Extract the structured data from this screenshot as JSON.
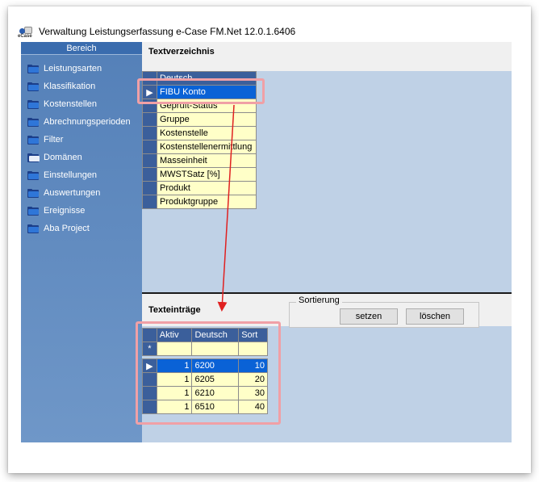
{
  "window": {
    "title": "Verwaltung Leistungserfassung e-Case FM.Net 12.0.1.6406",
    "icon_tag": "eCase"
  },
  "sidebar": {
    "header": "Bereich",
    "items": [
      {
        "label": "Leistungsarten"
      },
      {
        "label": "Klassifikation"
      },
      {
        "label": "Kostenstellen"
      },
      {
        "label": "Abrechnungsperioden"
      },
      {
        "label": "Filter"
      },
      {
        "label": "Domänen"
      },
      {
        "label": "Einstellungen"
      },
      {
        "label": "Auswertungen"
      },
      {
        "label": "Ereignisse"
      },
      {
        "label": "Aba Project"
      }
    ]
  },
  "textverzeichnis": {
    "title": "Textverzeichnis",
    "column_header": "Deutsch",
    "rows": [
      "FIBU Konto",
      "Geprüft-Status",
      "Gruppe",
      "Kostenstelle",
      "Kostenstellenermittlung",
      "Masseinheit",
      "MWSTSatz [%]",
      "Produkt",
      "Produktgruppe"
    ],
    "current_row_marker": "▶"
  },
  "texteintraege": {
    "title": "Texteinträge",
    "columns": {
      "aktiv": "Aktiv",
      "deutsch": "Deutsch",
      "sort": "Sort"
    },
    "new_row_marker": "*",
    "current_row_marker": "▶",
    "rows": [
      {
        "aktiv": "1",
        "deutsch": "6200",
        "sort": "10"
      },
      {
        "aktiv": "1",
        "deutsch": "6205",
        "sort": "20"
      },
      {
        "aktiv": "1",
        "deutsch": "6210",
        "sort": "30"
      },
      {
        "aktiv": "1",
        "deutsch": "6510",
        "sort": "40"
      }
    ]
  },
  "sortierung": {
    "legend": "Sortierung",
    "set_label": "setzen",
    "delete_label": "löschen"
  },
  "colors": {
    "highlight": "#f0a0a6",
    "arrow": "#e02020",
    "selection": "#0a62d6",
    "grid_header": "#3b5f9b",
    "cell": "#ffffc8"
  }
}
